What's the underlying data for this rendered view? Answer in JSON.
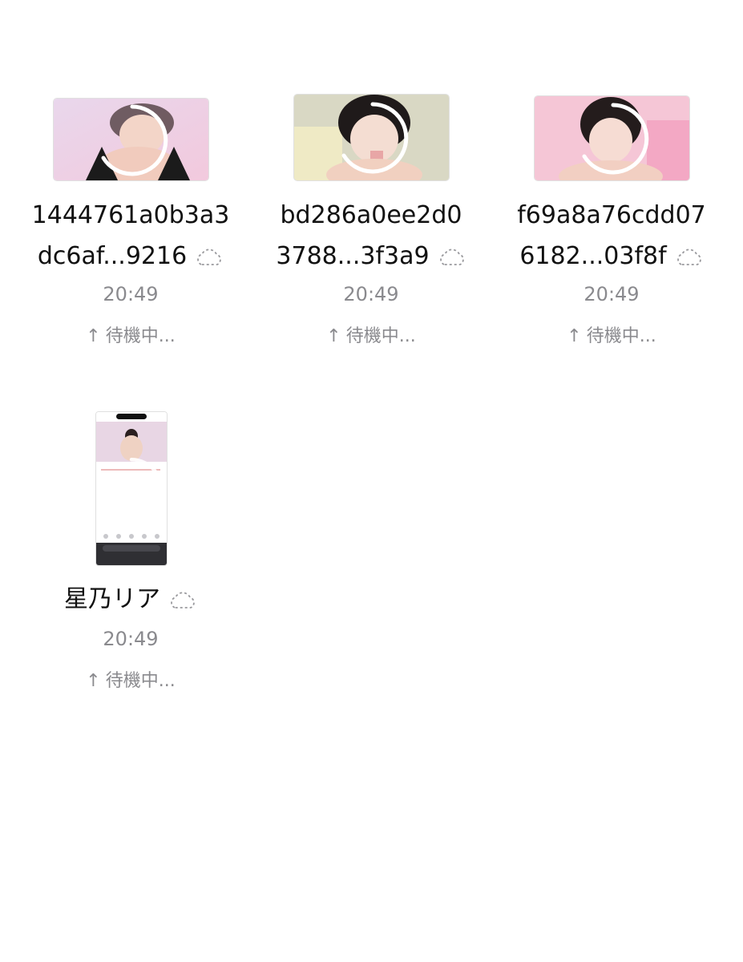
{
  "files": [
    {
      "name_line1": "1444761a0b3a3",
      "name_line2": "dc6af...9216",
      "time": "20:49",
      "status": "待機中...",
      "status_icon": "arrow-up-icon",
      "cloud_icon": "cloud-dashed-icon"
    },
    {
      "name_line1": "bd286a0ee2d0",
      "name_line2": "3788...3f3a9",
      "time": "20:49",
      "status": "待機中...",
      "status_icon": "arrow-up-icon",
      "cloud_icon": "cloud-dashed-icon"
    },
    {
      "name_line1": "f69a8a76cdd07",
      "name_line2": "6182...03f8f",
      "time": "20:49",
      "status": "待機中...",
      "status_icon": "arrow-up-icon",
      "cloud_icon": "cloud-dashed-icon"
    },
    {
      "name_line1": "星乃リア",
      "time": "20:49",
      "status": "待機中...",
      "status_icon": "arrow-up-icon",
      "cloud_icon": "cloud-dashed-icon"
    }
  ],
  "colors": {
    "text": "#111111",
    "secondary": "#8a8a8e",
    "ring": "#ffffff"
  }
}
